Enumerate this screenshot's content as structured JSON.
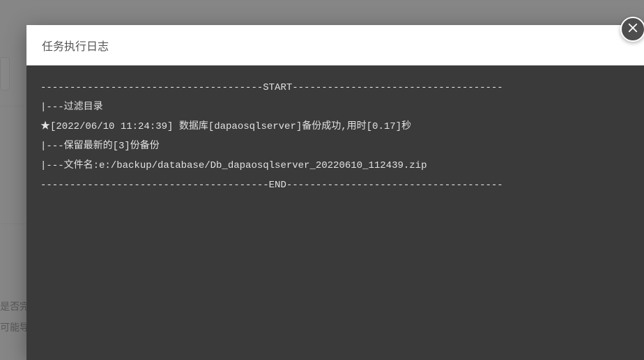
{
  "background": {
    "snippet1": "是否完",
    "snippet2": "可能导"
  },
  "modal": {
    "title": "任务执行日志",
    "log": {
      "divider_start": "--------------------------------------START------------------------------------",
      "divider_end": "---------------------------------------END-------------------------------------",
      "lines": [
        "|---过滤目录",
        "★[2022/06/10 11:24:39] 数据库[dapaosqlserver]备份成功,用时[0.17]秒",
        "|---保留最新的[3]份备份",
        "|---文件名:e:/backup/database/Db_dapaosqlserver_20220610_112439.zip"
      ]
    }
  },
  "close_label": "Close"
}
